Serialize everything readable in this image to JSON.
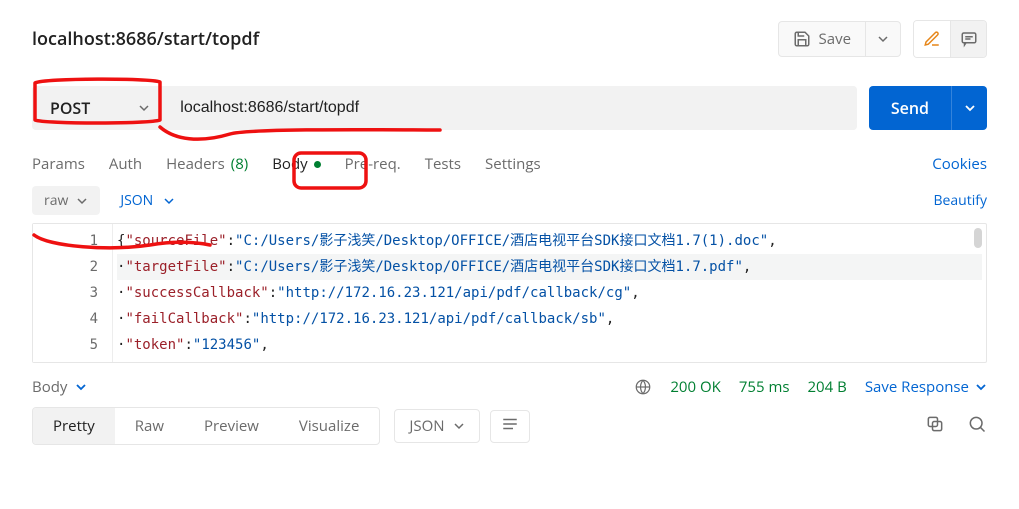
{
  "title": "localhost:8686/start/topdf",
  "header": {
    "save_label": "Save"
  },
  "request": {
    "method": "POST",
    "url": "localhost:8686/start/topdf",
    "send_label": "Send"
  },
  "tabs": {
    "items": [
      {
        "label": "Params"
      },
      {
        "label": "Auth"
      },
      {
        "label": "Headers",
        "count": "(8)"
      },
      {
        "label": "Body",
        "active": true,
        "indicator": true
      },
      {
        "label": "Pre-req."
      },
      {
        "label": "Tests"
      },
      {
        "label": "Settings"
      }
    ],
    "cookies": "Cookies"
  },
  "body_type": {
    "raw": "raw",
    "format": "JSON",
    "beautify": "Beautify"
  },
  "editor": {
    "lines": [
      {
        "n": "1",
        "key": "sourceFile",
        "value": "C:/Users/影子浅笑/Desktop/OFFICE/酒店电视平台SDK接口文档1.7(1).doc",
        "prefix": "{"
      },
      {
        "n": "2",
        "key": "targetFile",
        "value": "C:/Users/影子浅笑/Desktop/OFFICE/酒店电视平台SDK接口文档1.7.pdf",
        "highlight": true
      },
      {
        "n": "3",
        "key": "successCallback",
        "value": "http://172.16.23.121/api/pdf/callback/cg"
      },
      {
        "n": "4",
        "key": "failCallback",
        "value": "http://172.16.23.121/api/pdf/callback/sb"
      },
      {
        "n": "5",
        "key": "token",
        "value": "123456"
      }
    ]
  },
  "response": {
    "body_label": "Body",
    "status": "200 OK",
    "time": "755 ms",
    "size": "204 B",
    "save": "Save Response"
  },
  "resp_tabs": {
    "items": [
      {
        "label": "Pretty",
        "active": true
      },
      {
        "label": "Raw"
      },
      {
        "label": "Preview"
      },
      {
        "label": "Visualize"
      }
    ],
    "format": "JSON"
  }
}
